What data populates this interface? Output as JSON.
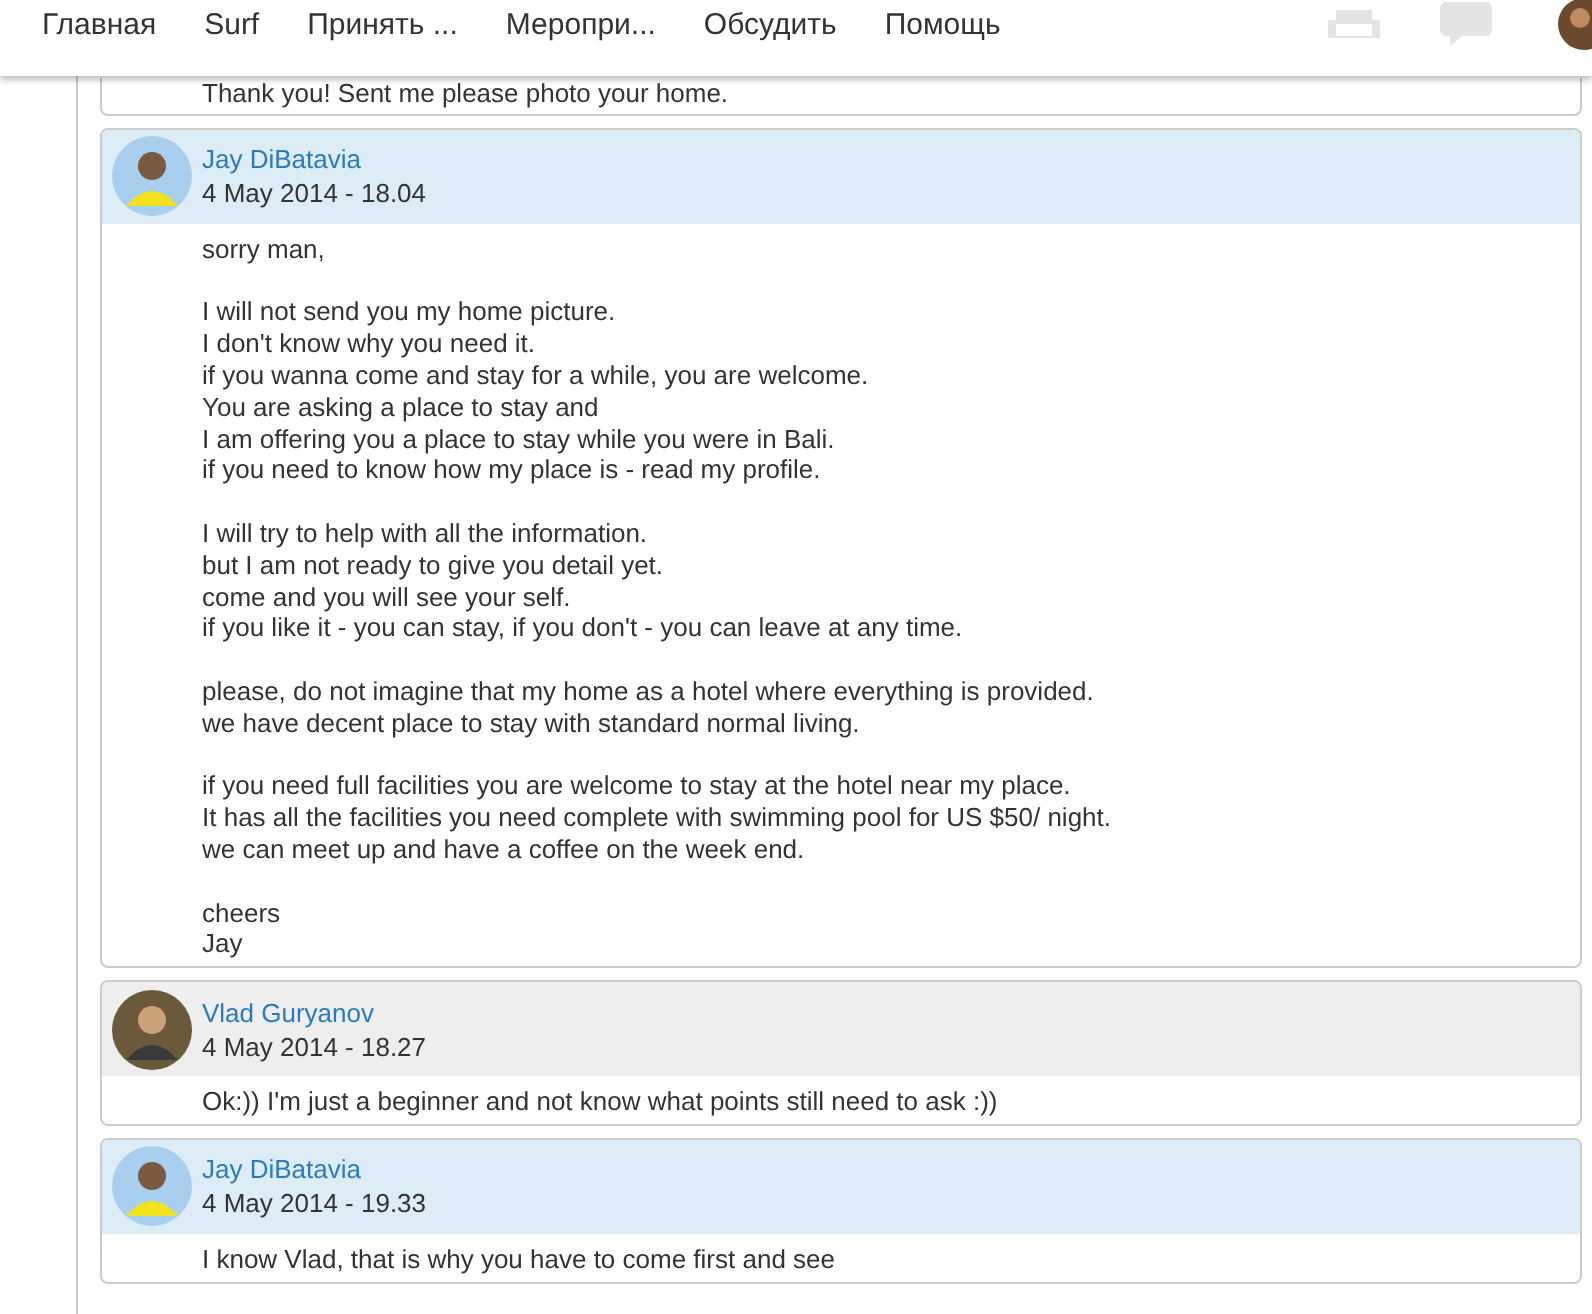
{
  "nav": {
    "items": [
      "Главная",
      "Surf",
      "Принять ...",
      "Меропри...",
      "Обсудить",
      "Помощь"
    ]
  },
  "messages": [
    {
      "paragraphs": [
        "Thank you! Sent me please photo your home."
      ]
    },
    {
      "author": "Jay DiBatavia",
      "date": "4 May 2014 - 18.04",
      "kind": "received",
      "paragraphs": [
        "sorry man,",
        "I will not send you my home picture.\nI don't know why you need it.\nif you wanna come and stay for a while, you are welcome.\nYou are asking a place to stay and\nI am offering you a place to stay while you were in Bali.\nif you need to know how my place is - read my profile.",
        "I will try to help with all the information.\nbut I am not ready to give you detail yet.\ncome and you will see your self.\nif you like it - you can stay, if you don't - you can leave at any time.",
        "please, do not imagine that my home as a hotel where everything is provided.\nwe have decent place to stay with standard normal living.",
        "if you need full facilities you are welcome to stay at the hotel near my place.\nIt has all the facilities you need complete with swimming pool for US $50/ night.\nwe can meet up and have a coffee on the week end.",
        "cheers\nJay"
      ]
    },
    {
      "author": "Vlad Guryanov",
      "date": "4 May 2014 - 18.27",
      "kind": "sent",
      "paragraphs": [
        "Ok:)) I'm just a beginner and not know what points still need to ask :))"
      ]
    },
    {
      "author": "Jay DiBatavia",
      "date": "4 May 2014 - 19.33",
      "kind": "received",
      "paragraphs": [
        "I know Vlad, that is why you have to come first and see"
      ]
    }
  ]
}
